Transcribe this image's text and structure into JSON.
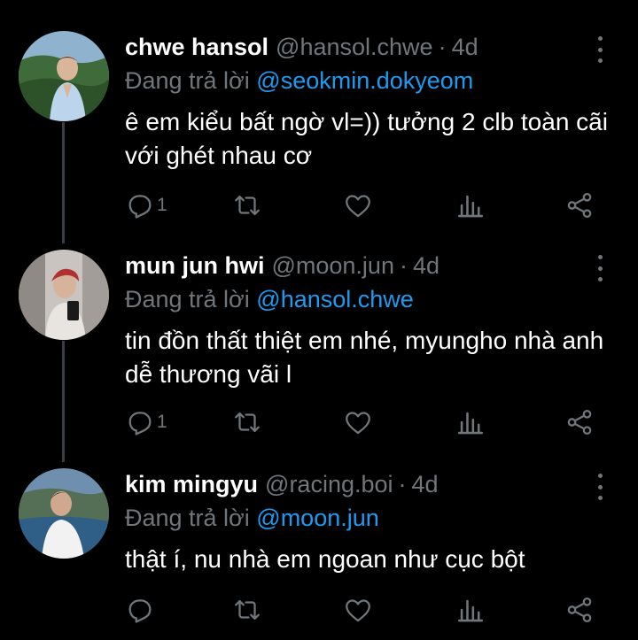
{
  "colors": {
    "background": "#000000",
    "text": "#ffffff",
    "muted": "#71767b",
    "link": "#1d9bf0"
  },
  "tweets": [
    {
      "name": "chwe hansol",
      "handle": "@hansol.chwe",
      "separator": "·",
      "time": "4d",
      "reply_label": "Đang trả lời",
      "reply_to": "@seokmin.dokyeom",
      "text": "ê em kiểu bất ngờ vl=)) tưởng 2 clb toàn cãi với ghét nhau cơ",
      "reply_count": "1",
      "avatar_icon": "avatar-photo"
    },
    {
      "name": "mun jun hwi",
      "handle": "@moon.jun",
      "separator": "·",
      "time": "4d",
      "reply_label": "Đang trả lời",
      "reply_to": "@hansol.chwe",
      "text": "tin đồn thất thiệt em nhé, myungho nhà anh dễ thương vãi l",
      "reply_count": "1",
      "avatar_icon": "avatar-photo"
    },
    {
      "name": "kim mingyu",
      "handle": "@racing.boi",
      "separator": "·",
      "time": "4d",
      "reply_label": "Đang trả lời",
      "reply_to": "@moon.jun",
      "text": "thật í, nu nhà em ngoan như cục bột",
      "reply_count": "",
      "avatar_icon": "avatar-photo"
    }
  ]
}
